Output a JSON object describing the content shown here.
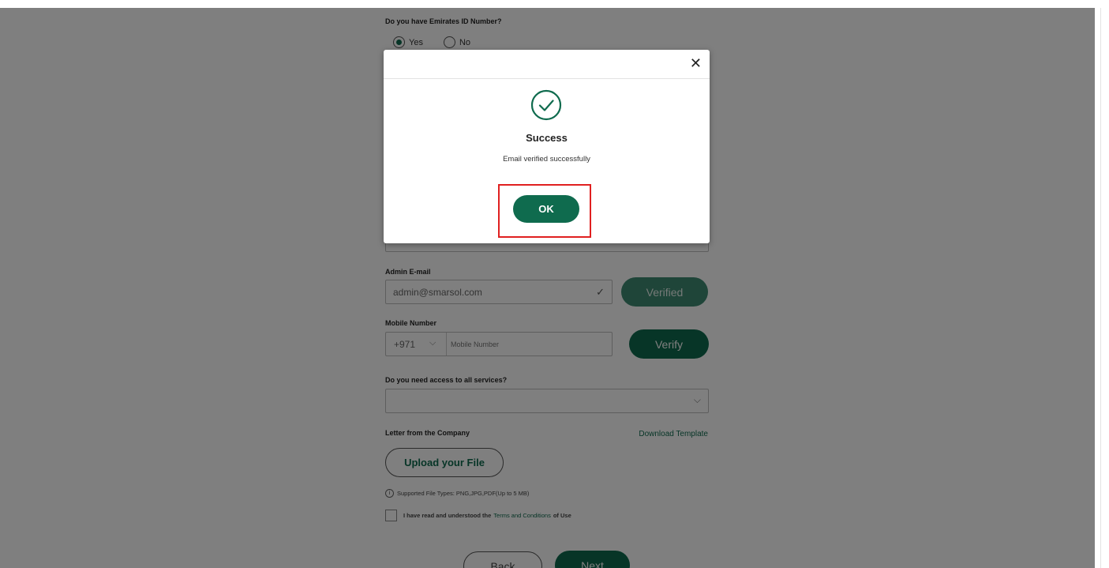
{
  "form": {
    "emirates_id": {
      "question": "Do you have Emirates ID Number?",
      "options": [
        "Yes",
        "No"
      ],
      "selected": "Yes"
    },
    "admin_email": {
      "label": "Admin E-mail",
      "value": "admin@smarsol.com",
      "status_button": "Verified"
    },
    "mobile": {
      "label": "Mobile Number",
      "country_code": "+971",
      "placeholder": "Mobile Number",
      "verify_button": "Verify"
    },
    "access_all": {
      "label": "Do you need access to all services?",
      "value": ""
    },
    "letter": {
      "label": "Letter from the Company",
      "download_link": "Download Template",
      "upload_button": "Upload your File",
      "supported_types": "Supported File Types: PNG,JPG,PDF(Up to 5 MB)"
    },
    "terms": {
      "prefix": "I have read and understood the",
      "link": "Terms and Conditions",
      "suffix": "of Use"
    },
    "buttons": {
      "back": "Back",
      "next": "Next"
    }
  },
  "modal": {
    "title": "Success",
    "message": "Email verified successfully",
    "ok_label": "OK",
    "close_glyph": "✕",
    "icon": "check-circle-icon"
  },
  "colors": {
    "accent": "#0f6b4e",
    "overlay": "rgba(0,0,0,0.5)",
    "highlight": "#e02020"
  }
}
